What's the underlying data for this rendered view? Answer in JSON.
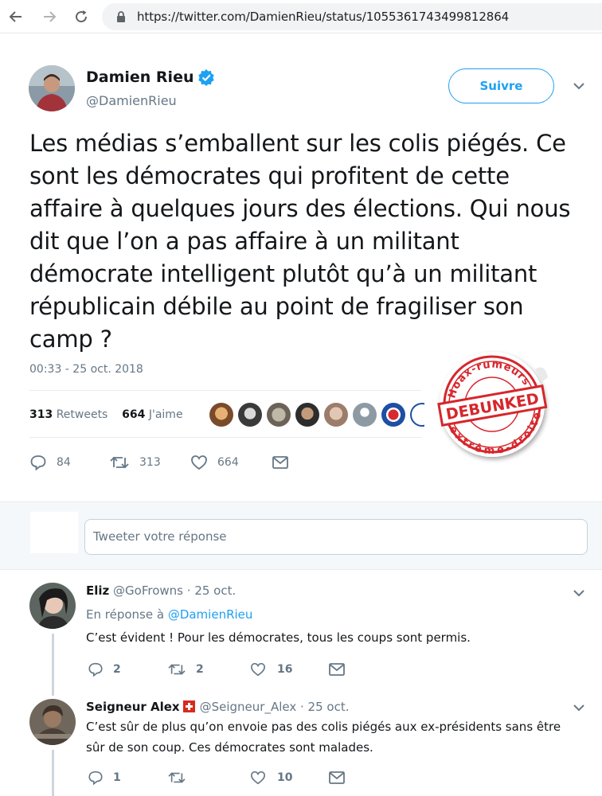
{
  "browser": {
    "url": "https://twitter.com/DamienRieu/status/1055361743499812864"
  },
  "tweet": {
    "author_name": "Damien Rieu",
    "author_handle": "@DamienRieu",
    "follow_label": "Suivre",
    "text": "Les médias s’emballent sur les colis piégés. Ce sont les démocrates qui profitent de cette affaire à quelques jours des élections. Qui nous dit que l’on a pas affaire à un militant démocrate intelligent plutôt qu’à un militant républicain débile au point de fragiliser son camp ?",
    "timestamp": "00:33 - 25 oct. 2018",
    "retweets_count": "313",
    "retweets_label": "Retweets",
    "likes_count": "664",
    "likes_label": "J'aime",
    "actions": {
      "replies": "84",
      "retweets": "313",
      "likes": "664"
    }
  },
  "stamp": {
    "top_text": "Hoax-rumeurs",
    "center_text": "DEBUNKED",
    "bottom_text": "extrême-droite"
  },
  "reply_box": {
    "placeholder": "Tweeter votre réponse"
  },
  "replies": [
    {
      "name": "Eliz",
      "handle": "@GoFrowns",
      "date": "· 25 oct.",
      "in_reply_prefix": "En réponse à",
      "in_reply_to": "@DamienRieu",
      "text": "C’est évident ! Pour les démocrates, tous les coups sont permis.",
      "actions": {
        "replies": "2",
        "retweets": "2",
        "likes": "16"
      }
    },
    {
      "name": "Seigneur Alex",
      "handle": "@Seigneur_Alex",
      "date": "· 25 oct.",
      "text": "C’est sûr de plus qu’on envoie pas des colis piégés aux ex-présidents sans être sûr de son coup. Ces démocrates sont malades.",
      "actions": {
        "replies": "1",
        "retweets": "",
        "likes": "10"
      }
    }
  ],
  "colors": {
    "accent": "#1da1f2",
    "text": "#14171a",
    "muted": "#657786",
    "stamp_red": "#d6262c"
  }
}
